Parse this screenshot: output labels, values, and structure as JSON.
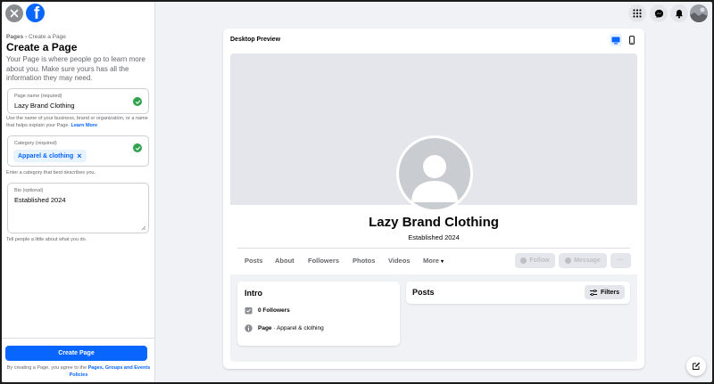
{
  "sidebar": {
    "breadcrumb_root": "Pages",
    "breadcrumb_sep": " › ",
    "breadcrumb_current": "Create a Page",
    "title": "Create a Page",
    "description": "Your Page is where people go to learn more about you. Make sure yours has all the information they may need.",
    "page_name": {
      "label": "Page name (required)",
      "value": "Lazy Brand Clothing",
      "helper": "Use the name of your business, brand or organization, or a name that helps explain your Page.",
      "helper_link": "Learn More"
    },
    "category": {
      "label": "Category (required)",
      "chip": "Apparel & clothing",
      "chip_remove": "×",
      "helper": "Enter a category that best describes you."
    },
    "bio": {
      "label": "Bio (optional)",
      "value": "Established 2024",
      "helper": "Tell people a little about what you do."
    },
    "create_button": "Create Page",
    "footer_prefix": "By creating a Page, you agree to the ",
    "footer_link": "Pages, Groups and Events Policies"
  },
  "preview": {
    "title": "Desktop Preview",
    "page_name": "Lazy Brand Clothing",
    "bio": "Established 2024",
    "tabs": [
      "Posts",
      "About",
      "Followers",
      "Photos",
      "Videos",
      "More"
    ],
    "more_caret": "▾",
    "follow_button": "Follow",
    "message_button": "Message",
    "more_button": "···",
    "intro": {
      "title": "Intro",
      "followers": "0 Followers",
      "page_type_label": "Page",
      "page_type_sep": " · ",
      "page_type_value": "Apparel & clothing"
    },
    "posts": {
      "title": "Posts",
      "filters_button": "Filters"
    }
  },
  "colors": {
    "accent": "#0866ff",
    "success": "#31a24c",
    "muted": "#65676b"
  }
}
